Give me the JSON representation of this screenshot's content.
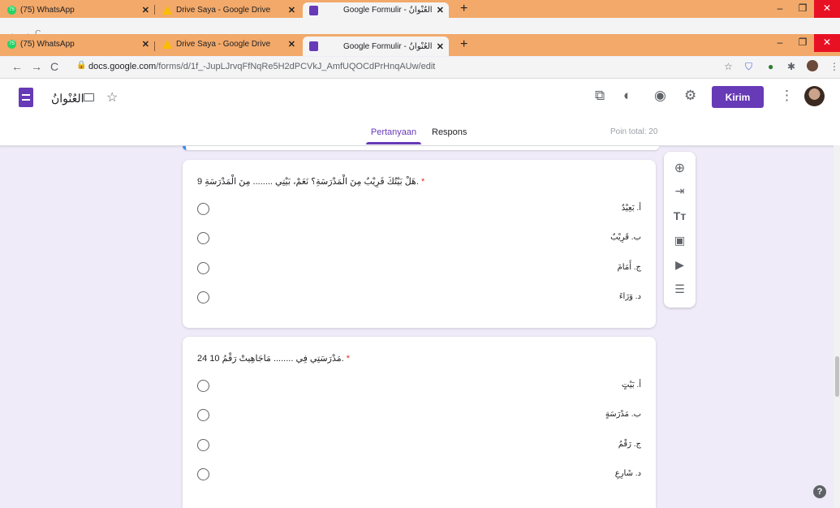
{
  "browser": {
    "tabs": [
      {
        "title": "(75) WhatsApp",
        "icon": "whatsapp-icon"
      },
      {
        "title": "Drive Saya - Google Drive",
        "icon": "google-drive-icon"
      },
      {
        "title": "Google Formulir - العُنْوانُ",
        "icon": "google-forms-icon"
      }
    ],
    "url_host": "docs.google.com",
    "url_path": "/forms/d/1f_-JupLJrvqFfNqRe5H2dPCVkJ_AmfUQOCdPrHnqAUw/edit"
  },
  "app": {
    "doc_title": "العُنْوانُ",
    "send_label": "Kirim",
    "tab_questions": "Pertanyaan",
    "tab_responses": "Respons",
    "points_total": "Poin total: 20"
  },
  "questions": [
    {
      "number": "9.",
      "text": "هَلْ بَيْتُكَ قَرِيْبٌ مِنَ الْمَدْرَسَةِ؟ نَعَمْ، بَيْتِي ........ مِنَ الْمَدْرَسَةِ",
      "required_mark": "*",
      "options": [
        "أ. بَعِيْدٌ",
        "ب. قَرِيْبٌ",
        "ج. أَمَامَ",
        "د. وَرَاءَ"
      ]
    },
    {
      "number": "10.",
      "text": "مَدْرَسَتِي فِي ........ مَاجَاهِيتْ رَقْمُ 24",
      "required_mark": "*",
      "options": [
        "أ. بَيْتٍ",
        "ب. مَدْرَسَةٍ",
        "ج. رَقْمُ",
        "د. شَارِعِ"
      ]
    }
  ],
  "colors": {
    "accent": "#673ab7",
    "background": "#f0ebf8",
    "tab_bar": "#f2a96a",
    "required": "#d93025"
  }
}
